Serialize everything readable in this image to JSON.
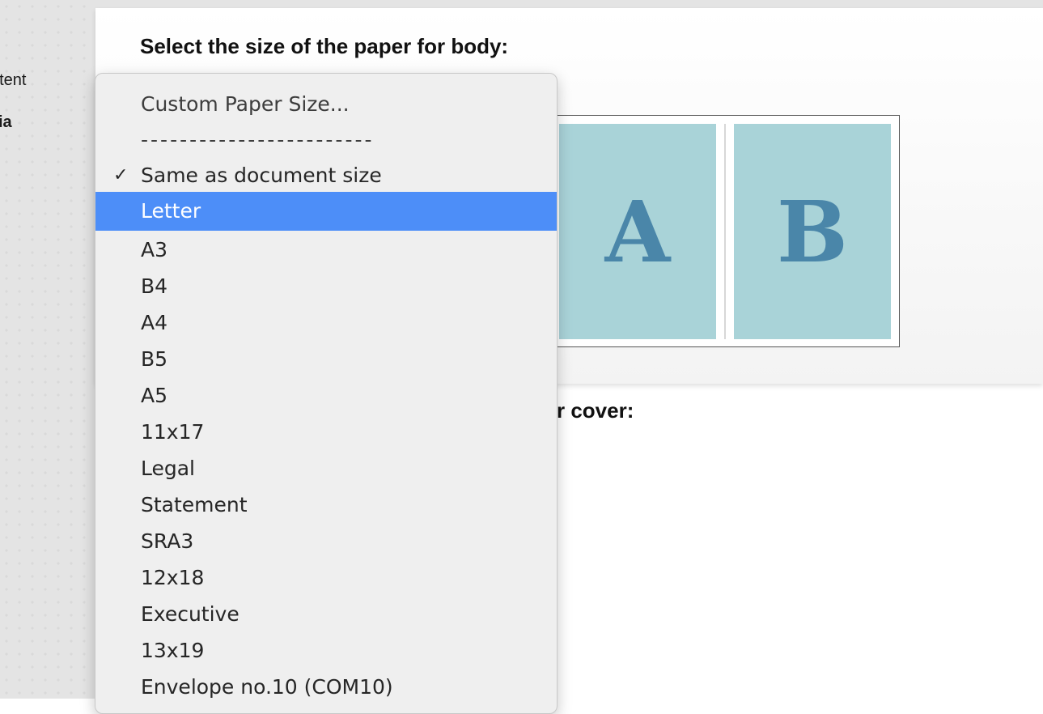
{
  "sidebar": {
    "items": [
      {
        "label": "ntent"
      },
      {
        "label": "ia"
      }
    ]
  },
  "body_section": {
    "heading": "Select the size of the paper for body:"
  },
  "preview": {
    "page_a": "A",
    "page_b": "B"
  },
  "cover_section": {
    "heading_visible": "r cover:"
  },
  "menu": {
    "items": [
      {
        "label": "Custom Paper Size...",
        "checked": false,
        "selected": false
      },
      {
        "label": "------------------------",
        "checked": false,
        "selected": false,
        "separator": true
      },
      {
        "label": "Same as document size",
        "checked": true,
        "selected": false
      },
      {
        "label": "Letter",
        "checked": false,
        "selected": true
      },
      {
        "label": "A3",
        "checked": false,
        "selected": false
      },
      {
        "label": "B4",
        "checked": false,
        "selected": false
      },
      {
        "label": "A4",
        "checked": false,
        "selected": false
      },
      {
        "label": "B5",
        "checked": false,
        "selected": false
      },
      {
        "label": "A5",
        "checked": false,
        "selected": false
      },
      {
        "label": "11x17",
        "checked": false,
        "selected": false
      },
      {
        "label": "Legal",
        "checked": false,
        "selected": false
      },
      {
        "label": "Statement",
        "checked": false,
        "selected": false
      },
      {
        "label": "SRA3",
        "checked": false,
        "selected": false
      },
      {
        "label": "12x18",
        "checked": false,
        "selected": false
      },
      {
        "label": "Executive",
        "checked": false,
        "selected": false
      },
      {
        "label": "13x19",
        "checked": false,
        "selected": false
      },
      {
        "label": "Envelope no.10 (COM10)",
        "checked": false,
        "selected": false
      }
    ],
    "check_glyph": "✓",
    "highlight_color": "#4d8ef8"
  }
}
